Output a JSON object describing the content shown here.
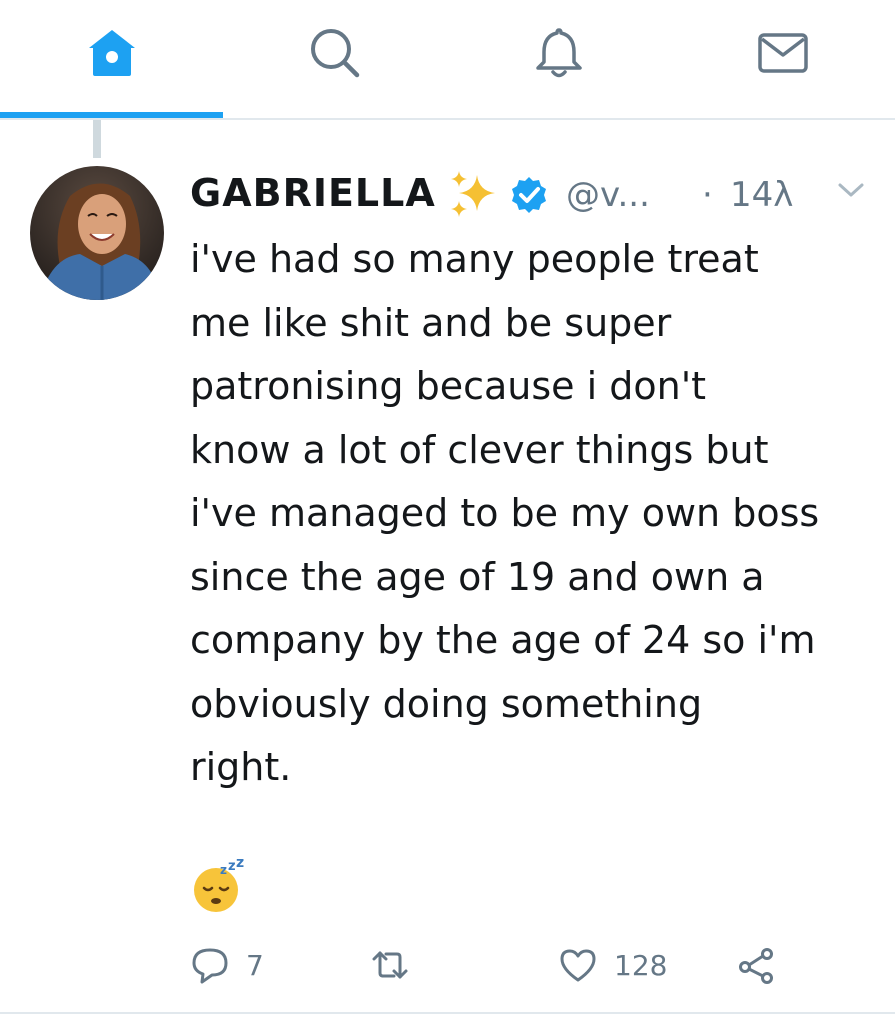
{
  "nav": {
    "tabs": [
      {
        "name": "home",
        "icon": "home-icon",
        "active": true
      },
      {
        "name": "search",
        "icon": "search-icon",
        "active": false
      },
      {
        "name": "notifications",
        "icon": "bell-icon",
        "active": false
      },
      {
        "name": "messages",
        "icon": "mail-icon",
        "active": false
      }
    ],
    "accent_color": "#1da1f2",
    "inactive_color": "#657786"
  },
  "tweet": {
    "display_name": "GABRIELLA",
    "name_emoji": "sparkles-icon",
    "verified": true,
    "handle": "@v...",
    "separator": "·",
    "timestamp": "14λ",
    "text": "i've had so many people treat\nme like shit and be super\npatronising because i don't\nknow a lot of clever things but\ni've managed to be my own boss\nsince the age of 19 and own a\ncompany by the age of 24 so i'm\nobviously doing something\nright.",
    "emoji": "sleeping-face-icon",
    "actions": {
      "reply_count": "7",
      "retweet_count": "",
      "like_count": "128"
    }
  }
}
